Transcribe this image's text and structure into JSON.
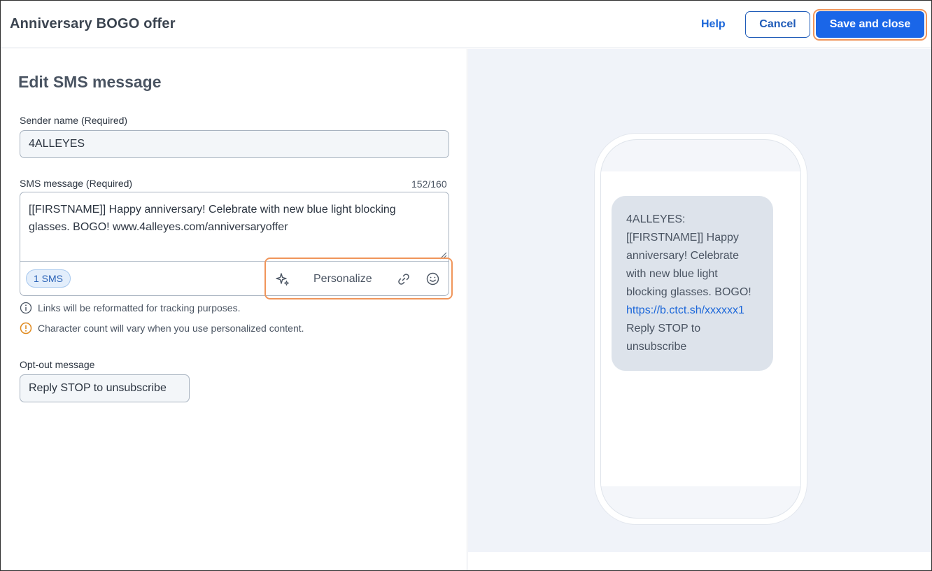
{
  "header": {
    "title": "Anniversary BOGO offer",
    "help_label": "Help",
    "cancel_label": "Cancel",
    "save_label": "Save and close"
  },
  "editor": {
    "section_title": "Edit SMS message",
    "sender": {
      "label": "Sender name (Required)",
      "value": "4ALLEYES"
    },
    "sms": {
      "label": "SMS message (Required)",
      "counter": "152/160",
      "text": "[[FIRSTNAME]] Happy anniversary! Celebrate with new blue light blocking glasses. BOGO! www.4alleyes.com/anniversaryoffer",
      "segment_badge": "1 SMS",
      "toolbar": {
        "ai_icon": "sparkle-icon",
        "personalize_label": "Personalize",
        "link_icon": "link-icon",
        "emoji_icon": "smiley-icon"
      }
    },
    "notes": {
      "links_note": "Links will be reformatted for tracking purposes.",
      "char_note": "Character count will vary when you use personalized content."
    },
    "opt_out": {
      "label": "Opt-out message",
      "value": "Reply STOP to unsubscribe"
    }
  },
  "preview": {
    "line1": "4ALLEYES:",
    "line2": "[[FIRSTNAME]] Happy",
    "line3": "anniversary! Celebrate",
    "line4": "with new blue light",
    "line5": "blocking glasses. BOGO!",
    "link": "https://b.ctct.sh/xxxxxx1",
    "line6": "Reply STOP to",
    "line7": "unsubscribe"
  },
  "colors": {
    "primary": "#1a66e8",
    "highlight": "#f0955a",
    "preview_bg": "#f0f3f9",
    "bubble_bg": "#dde3eb",
    "warning": "#e08a1e"
  }
}
